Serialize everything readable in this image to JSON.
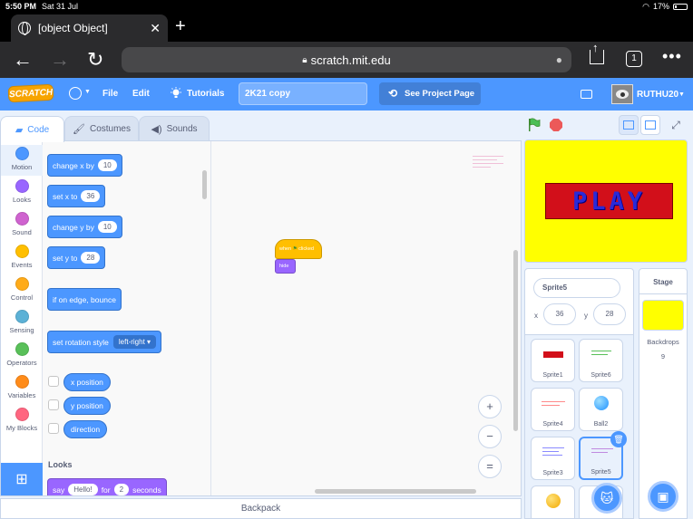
{
  "status_bar": {
    "time": "5:50 PM",
    "date": "Sat 31 Jul",
    "battery": "17%"
  },
  "browser": {
    "tab_title": "[object Object]",
    "url": "scratch.mit.edu",
    "tab_count": "1"
  },
  "menu": {
    "file": "File",
    "edit": "Edit",
    "tutorials": "Tutorials",
    "project_title": "2K21 copy",
    "see_project_page": "See Project Page",
    "username": "RUTHU20",
    "logo": "SCRATCH"
  },
  "editor_tabs": {
    "code": "Code",
    "costumes": "Costumes",
    "sounds": "Sounds"
  },
  "categories": [
    {
      "label": "Motion",
      "color": "#4c97ff"
    },
    {
      "label": "Looks",
      "color": "#9966ff"
    },
    {
      "label": "Sound",
      "color": "#cf63cf"
    },
    {
      "label": "Events",
      "color": "#ffbf00"
    },
    {
      "label": "Control",
      "color": "#ffab19"
    },
    {
      "label": "Sensing",
      "color": "#5cb1d6"
    },
    {
      "label": "Operators",
      "color": "#59c059"
    },
    {
      "label": "Variables",
      "color": "#ff8c1a"
    },
    {
      "label": "My Blocks",
      "color": "#ff6680"
    }
  ],
  "palette": {
    "change_x": {
      "label": "change x by",
      "value": "10"
    },
    "set_x": {
      "label": "set x to",
      "value": "36"
    },
    "change_y": {
      "label": "change y by",
      "value": "10"
    },
    "set_y": {
      "label": "set y to",
      "value": "28"
    },
    "bounce": "if on edge, bounce",
    "rotation": {
      "label": "set rotation style",
      "value": "left-right"
    },
    "x_position": "x position",
    "y_position": "y position",
    "direction": "direction",
    "looks_heading": "Looks",
    "say": {
      "label": "say",
      "msg": "Hello!",
      "for": "for",
      "secs": "2",
      "unit": "seconds"
    }
  },
  "workspace": {
    "hat_label": "when",
    "hat_label2": "clicked",
    "hide_label": "hide",
    "zoom_in": "+",
    "zoom_out": "−",
    "zoom_reset": "="
  },
  "backpack": "Backpack",
  "sprite_info": {
    "name": "Sprite5",
    "x_label": "x",
    "x": "36",
    "y_label": "y",
    "y": "28"
  },
  "sprites": [
    "Sprite1",
    "Sprite6",
    "Sprite4",
    "Ball2",
    "Sprite3",
    "Sprite5"
  ],
  "stage_target": {
    "title": "Stage",
    "backdrops_label": "Backdrops",
    "backdrops_count": "9"
  },
  "stage_text": "PLAY",
  "colors": {
    "accent": "#4c97ff",
    "stage_bg": "#ffff00",
    "play_box": "#d20f1a"
  }
}
